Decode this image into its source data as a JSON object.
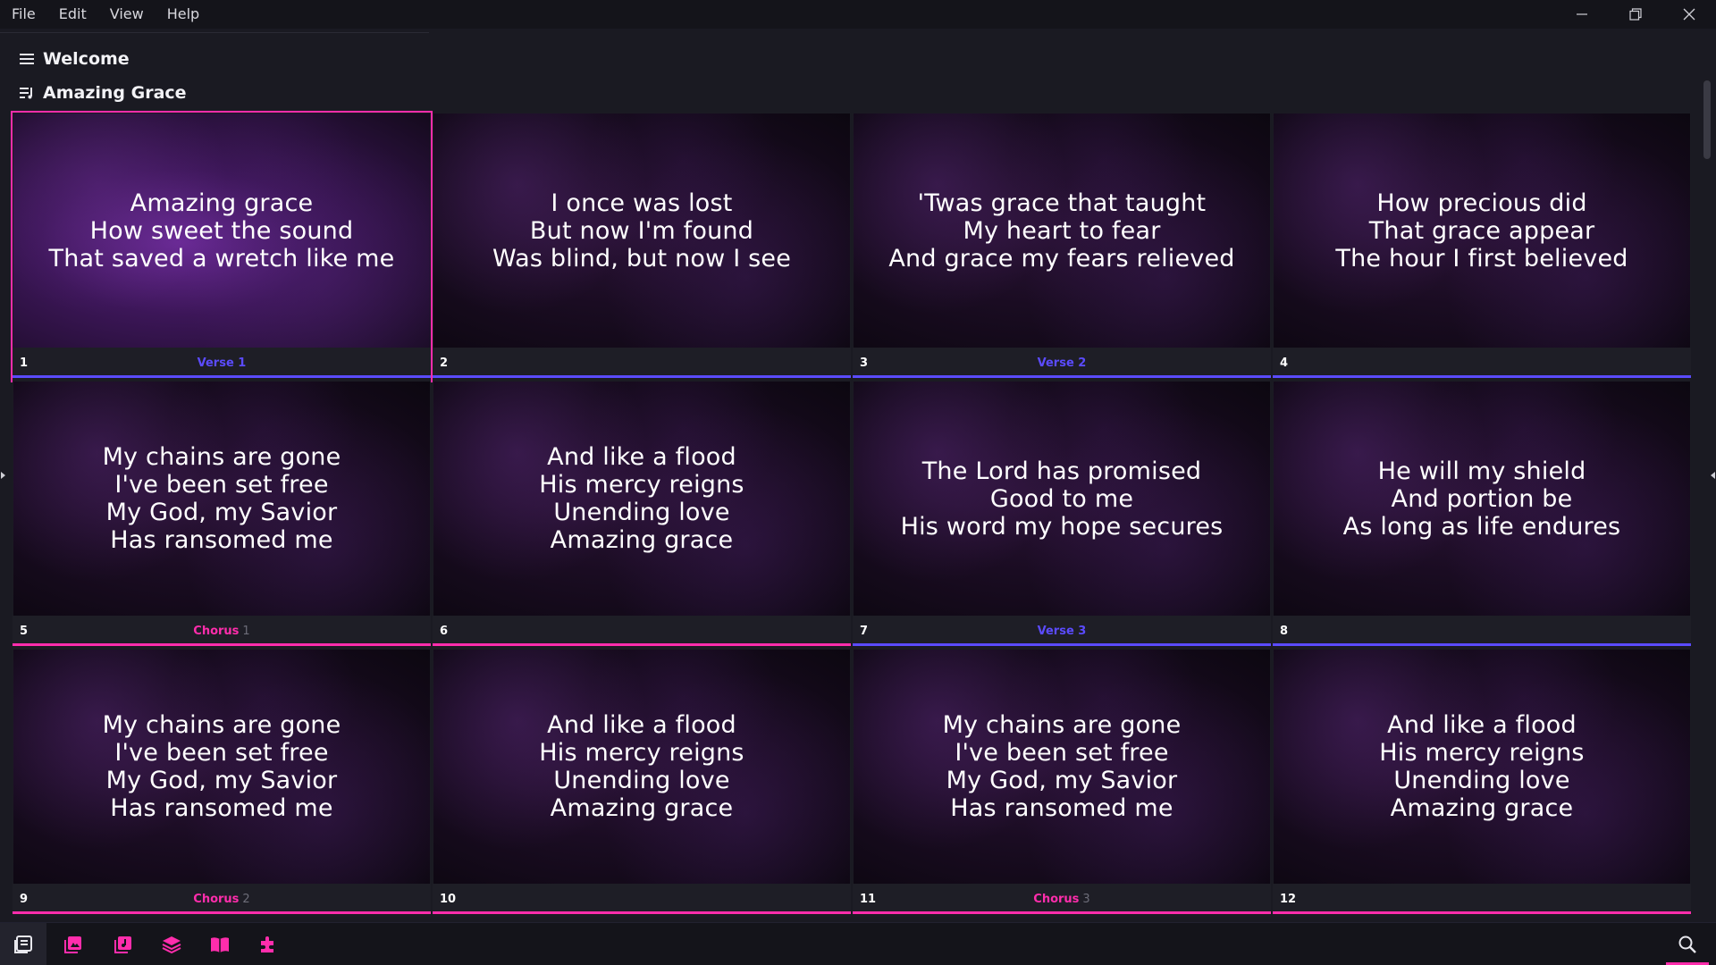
{
  "menu": [
    "File",
    "Edit",
    "View",
    "Help"
  ],
  "project": {
    "welcome": "Welcome",
    "song": "Amazing Grace"
  },
  "colors": {
    "accent": "#ff2dac",
    "verse": "#5b4bff",
    "chorus": "#ff2dac"
  },
  "slides": [
    {
      "num": "1",
      "group": "Verse 1",
      "group_idx": "",
      "color": "verse",
      "lines": [
        "Amazing grace",
        "How sweet the sound",
        "That saved a wretch like me"
      ],
      "active": true
    },
    {
      "num": "2",
      "group": "",
      "group_idx": "",
      "color": "verse",
      "lines": [
        "I once was lost",
        "But now I'm found",
        "Was blind, but now I see"
      ]
    },
    {
      "num": "3",
      "group": "Verse 2",
      "group_idx": "",
      "color": "verse",
      "lines": [
        "'Twas grace that taught",
        "My heart to fear",
        "And grace my fears relieved"
      ]
    },
    {
      "num": "4",
      "group": "",
      "group_idx": "",
      "color": "verse",
      "lines": [
        "How precious did",
        "That grace appear",
        "The hour I first believed"
      ]
    },
    {
      "num": "5",
      "group": "Chorus",
      "group_idx": "1",
      "color": "chorus",
      "lines": [
        "My chains are gone",
        "I've been set free",
        "My God, my Savior",
        "Has ransomed me"
      ]
    },
    {
      "num": "6",
      "group": "",
      "group_idx": "",
      "color": "chorus",
      "lines": [
        "And like a flood",
        "His mercy reigns",
        "Unending love",
        "Amazing grace"
      ]
    },
    {
      "num": "7",
      "group": "Verse 3",
      "group_idx": "",
      "color": "verse",
      "lines": [
        "The Lord has promised",
        "Good to me",
        "His word my hope secures"
      ]
    },
    {
      "num": "8",
      "group": "",
      "group_idx": "",
      "color": "verse",
      "lines": [
        "He will my shield",
        "And portion be",
        "As long as life endures"
      ]
    },
    {
      "num": "9",
      "group": "Chorus",
      "group_idx": "2",
      "color": "chorus",
      "lines": [
        "My chains are gone",
        "I've been set free",
        "My God, my Savior",
        "Has ransomed me"
      ]
    },
    {
      "num": "10",
      "group": "",
      "group_idx": "",
      "color": "chorus",
      "lines": [
        "And like a flood",
        "His mercy reigns",
        "Unending love",
        "Amazing grace"
      ]
    },
    {
      "num": "11",
      "group": "Chorus",
      "group_idx": "3",
      "color": "chorus",
      "lines": [
        "My chains are gone",
        "I've been set free",
        "My God, my Savior",
        "Has ransomed me"
      ]
    },
    {
      "num": "12",
      "group": "",
      "group_idx": "",
      "color": "chorus",
      "lines": [
        "And like a flood",
        "His mercy reigns",
        "Unending love",
        "Amazing grace"
      ]
    }
  ],
  "toolbar": {
    "icons": [
      "shows-icon",
      "media-icon",
      "audio-icon",
      "overlays-icon",
      "scripture-icon",
      "templates-icon"
    ],
    "search_icon": "search-icon"
  }
}
